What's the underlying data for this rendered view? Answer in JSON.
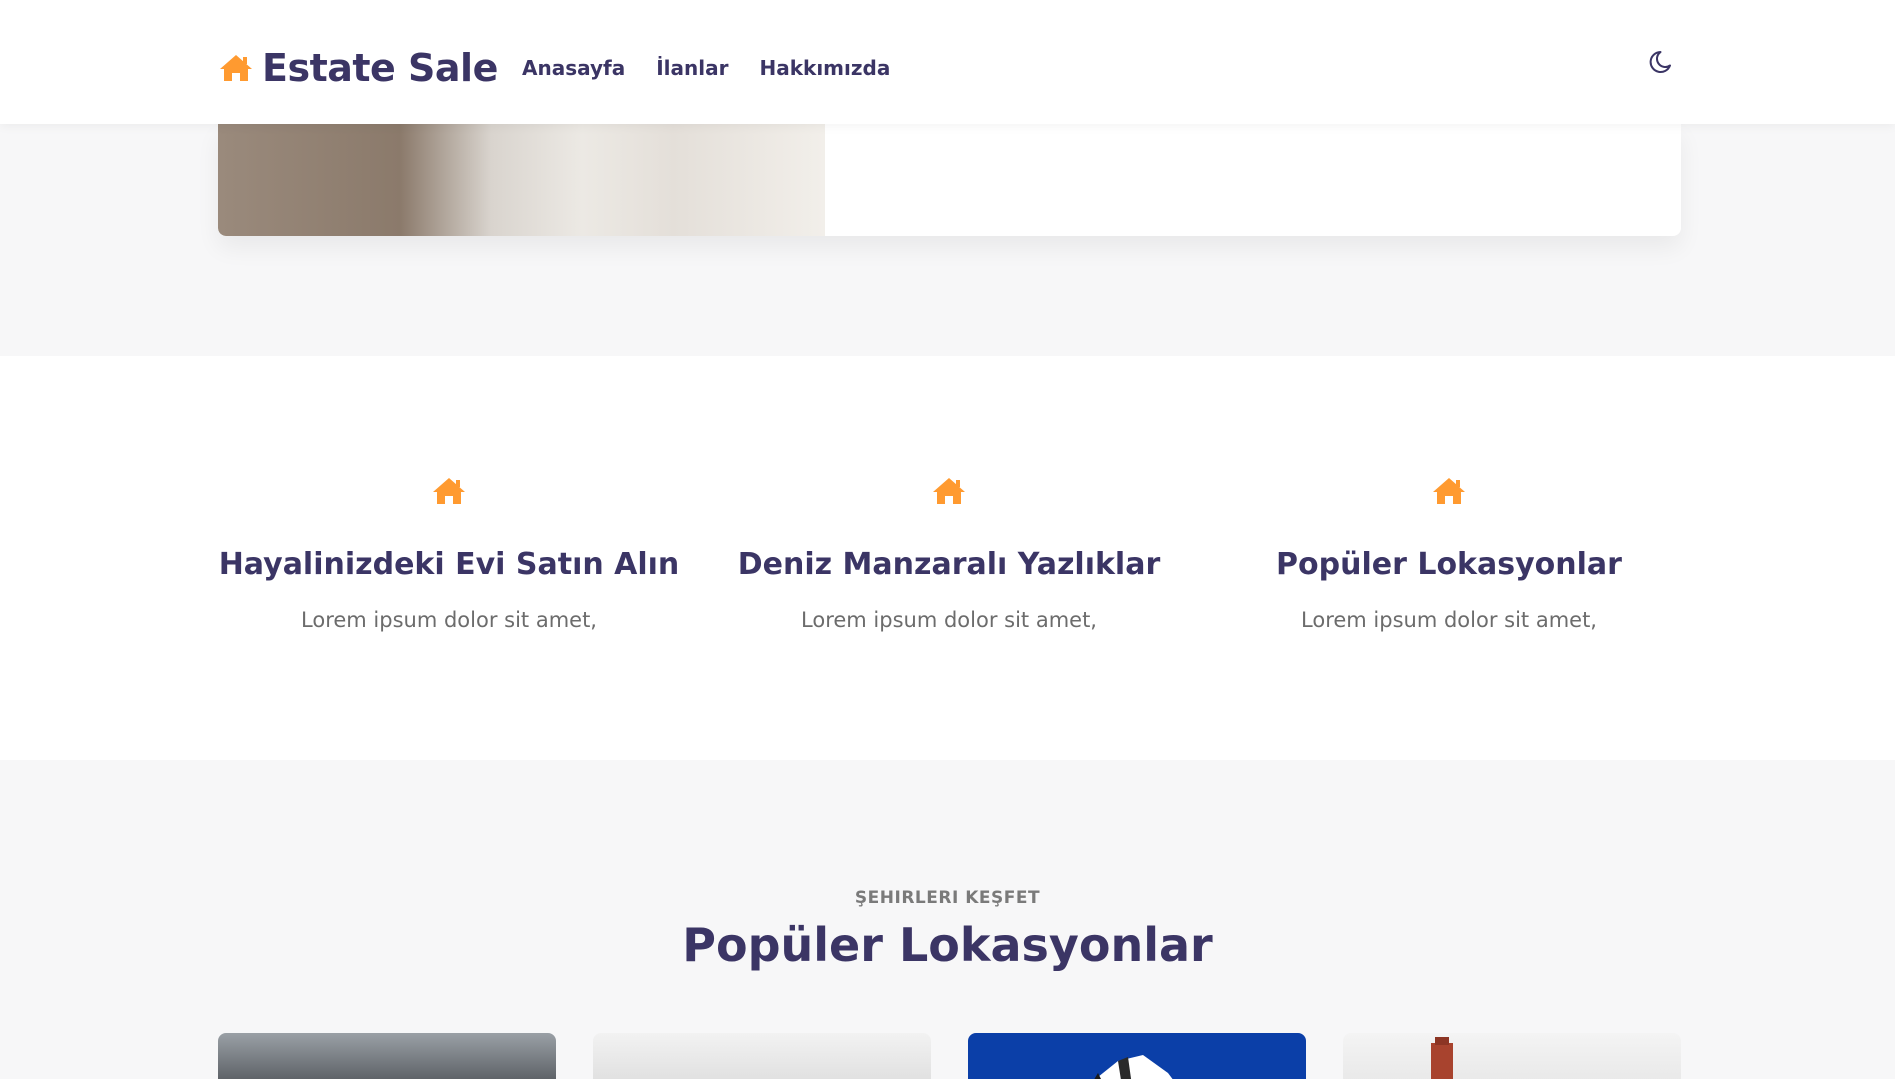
{
  "header": {
    "brand": "Estate Sale",
    "nav": [
      "Anasayfa",
      "İlanlar",
      "Hakkımızda"
    ]
  },
  "features": [
    {
      "title": "Hayalinizdeki Evi Satın Alın",
      "text": "Lorem ipsum dolor sit amet,"
    },
    {
      "title": "Deniz Manzaralı Yazlıklar",
      "text": "Lorem ipsum dolor sit amet,"
    },
    {
      "title": "Popüler Lokasyonlar",
      "text": "Lorem ipsum dolor sit amet,"
    }
  ],
  "locations": {
    "kicker": "ŞEHIRLERI KEŞFET",
    "title": "Popüler Lokasyonlar"
  },
  "colors": {
    "accent": "#ff9a30",
    "text_primary": "#3b3565",
    "text_muted": "#6c6c6c",
    "page_bg": "#f7f7f8",
    "card_bg": "#ffffff"
  },
  "icons": {
    "brand": "home-icon",
    "theme_toggle": "moon-icon",
    "feature": "home-icon"
  }
}
